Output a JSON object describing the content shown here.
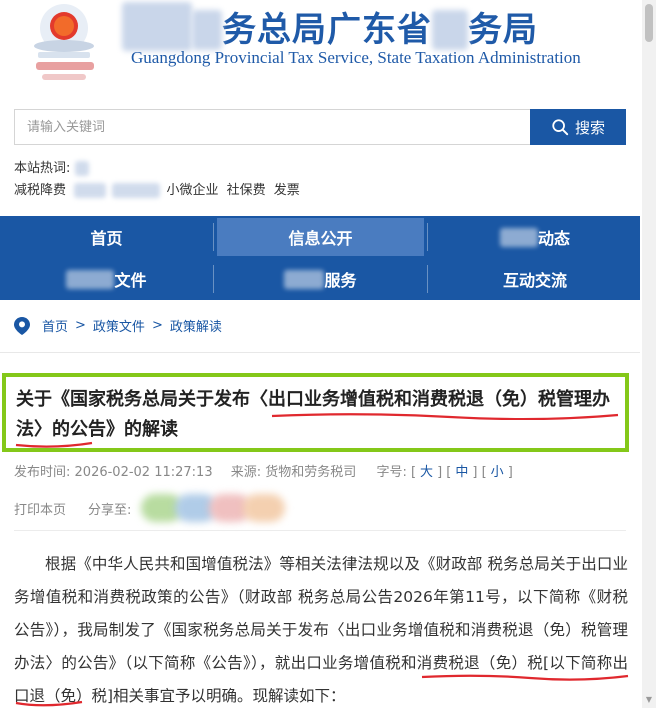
{
  "header": {
    "title_cn_part1": "国家",
    "title_cn_blur1": "税",
    "title_cn_part2": "务总局广东省",
    "title_cn_blur2": "税",
    "title_cn_part3": "务局",
    "title_en": "Guangdong Provincial Tax Service, State Taxation Administration"
  },
  "search": {
    "placeholder": "请输入关键词",
    "button_label": "搜索"
  },
  "hot": {
    "label": "本站热词:",
    "items": [
      "减税降费",
      "个税",
      "增值税",
      "小微企业",
      "社保费",
      "发票"
    ]
  },
  "nav": {
    "items": [
      "首页",
      "信息公开",
      "新闻动态",
      "政策文件",
      "纳税服务",
      "互动交流"
    ]
  },
  "breadcrumb": {
    "items": [
      "首页",
      "政策文件",
      "政策解读"
    ],
    "separator": ">"
  },
  "article": {
    "title": "关于《国家税务总局关于发布〈出口业务增值税和消费税退（免）税管理办法〉的公告》的解读",
    "meta": {
      "publish_label": "发布时间:",
      "publish_time": "2026-02-02 11:27:13",
      "source_label": "来源:",
      "source": "货物和劳务税司",
      "font_label": "字号:",
      "font_large": "大",
      "font_medium": "中",
      "font_small": "小"
    },
    "print_label": "打印本页",
    "share_label": "分享至:",
    "paragraph": "根据《中华人民共和国增值税法》等相关法律法规以及《财政部 税务总局关于出口业务增值税和消费税政策的公告》（财政部 税务总局公告2026年第11号，以下简称《财税公告》），我局制发了《国家税务总局关于发布〈出口业务增值税和消费税退（免）税管理办法〉的公告》（以下简称《公告》），就出口业务增值税和消费税退（免）税[以下简称出口退（免）税]相关事宜予以明确。现解读如下："
  },
  "colors": {
    "brand_blue": "#1a57a4",
    "nav_active": "#4a7cc0",
    "highlight_green": "#84c819",
    "annotation_red": "#e0282e"
  }
}
